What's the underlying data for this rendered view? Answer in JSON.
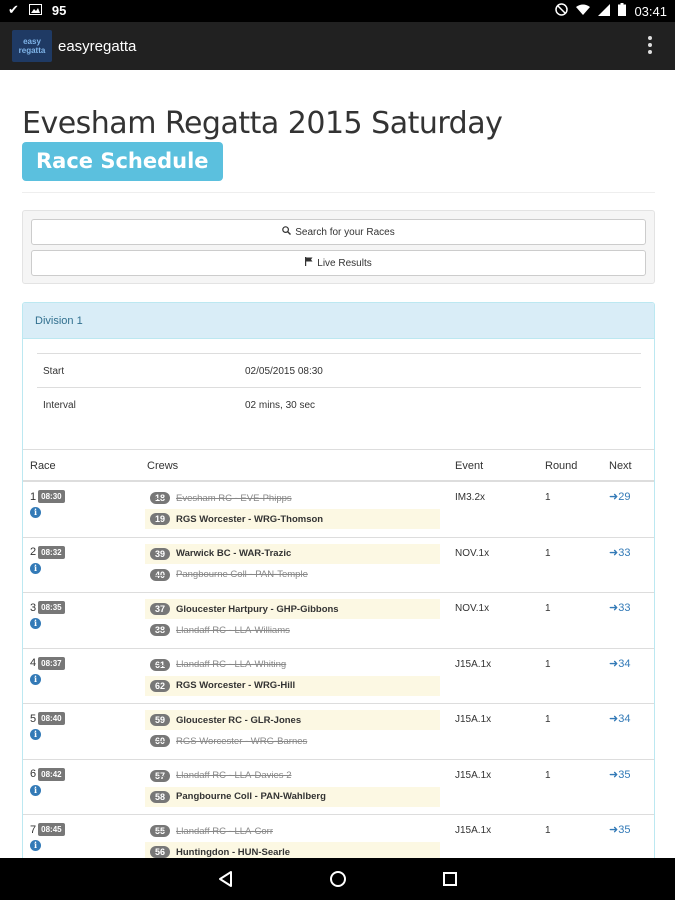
{
  "status_bar": {
    "battery_left": "95",
    "time": "03:41",
    "icons": [
      "check-icon",
      "image-icon",
      "dnd-icon",
      "wifi-icon",
      "signal-icon",
      "battery-icon"
    ]
  },
  "app_bar": {
    "logo_text": "easy regatta",
    "title": "easyregatta",
    "menu_icon": "overflow-menu-icon"
  },
  "page": {
    "title": "Evesham Regatta 2015 Saturday",
    "subtitle": "Race Schedule",
    "search_button": "Search for your Races",
    "live_button": "Live Results"
  },
  "division": {
    "name": "Division 1",
    "start_label": "Start",
    "start_value": "02/05/2015 08:30",
    "interval_label": "Interval",
    "interval_value": "02 mins, 30 sec"
  },
  "table": {
    "headers": {
      "race": "Race",
      "crews": "Crews",
      "event": "Event",
      "round": "Round",
      "next": "Next"
    },
    "rows": [
      {
        "race": "1",
        "time": "08:30",
        "crews": [
          {
            "num": "18",
            "name": "Evesham RC - EVE-Phipps",
            "state": "lose"
          },
          {
            "num": "19",
            "name": "RGS Worcester - WRG-Thomson",
            "state": "win"
          }
        ],
        "event": "IM3.2x",
        "round": "1",
        "next": "29"
      },
      {
        "race": "2",
        "time": "08:32",
        "crews": [
          {
            "num": "39",
            "name": "Warwick BC - WAR-Trazic",
            "state": "win"
          },
          {
            "num": "40",
            "name": "Pangbourne Coll - PAN-Temple",
            "state": "lose"
          }
        ],
        "event": "NOV.1x",
        "round": "1",
        "next": "33"
      },
      {
        "race": "3",
        "time": "08:35",
        "crews": [
          {
            "num": "37",
            "name": "Gloucester Hartpury - GHP-Gibbons",
            "state": "win"
          },
          {
            "num": "38",
            "name": "Llandaff RC - LLA-Williams",
            "state": "lose"
          }
        ],
        "event": "NOV.1x",
        "round": "1",
        "next": "33"
      },
      {
        "race": "4",
        "time": "08:37",
        "crews": [
          {
            "num": "61",
            "name": "Llandaff RC - LLA-Whiting",
            "state": "lose"
          },
          {
            "num": "62",
            "name": "RGS Worcester - WRG-Hill",
            "state": "win"
          }
        ],
        "event": "J15A.1x",
        "round": "1",
        "next": "34"
      },
      {
        "race": "5",
        "time": "08:40",
        "crews": [
          {
            "num": "59",
            "name": "Gloucester RC - GLR-Jones",
            "state": "win"
          },
          {
            "num": "60",
            "name": "RGS Worcester - WRG-Barnes",
            "state": "lose"
          }
        ],
        "event": "J15A.1x",
        "round": "1",
        "next": "34"
      },
      {
        "race": "6",
        "time": "08:42",
        "crews": [
          {
            "num": "57",
            "name": "Llandaff RC - LLA-Davies 2",
            "state": "lose"
          },
          {
            "num": "58",
            "name": "Pangbourne Coll - PAN-Wahlberg",
            "state": "win"
          }
        ],
        "event": "J15A.1x",
        "round": "1",
        "next": "35"
      },
      {
        "race": "7",
        "time": "08:45",
        "crews": [
          {
            "num": "55",
            "name": "Llandaff RC - LLA-Corr",
            "state": "lose"
          },
          {
            "num": "56",
            "name": "Huntingdon - HUN-Searle",
            "state": "win"
          }
        ],
        "event": "J15A.1x",
        "round": "1",
        "next": "35"
      }
    ]
  },
  "nav": {
    "icons": [
      "back-icon",
      "home-icon",
      "recents-icon"
    ]
  }
}
